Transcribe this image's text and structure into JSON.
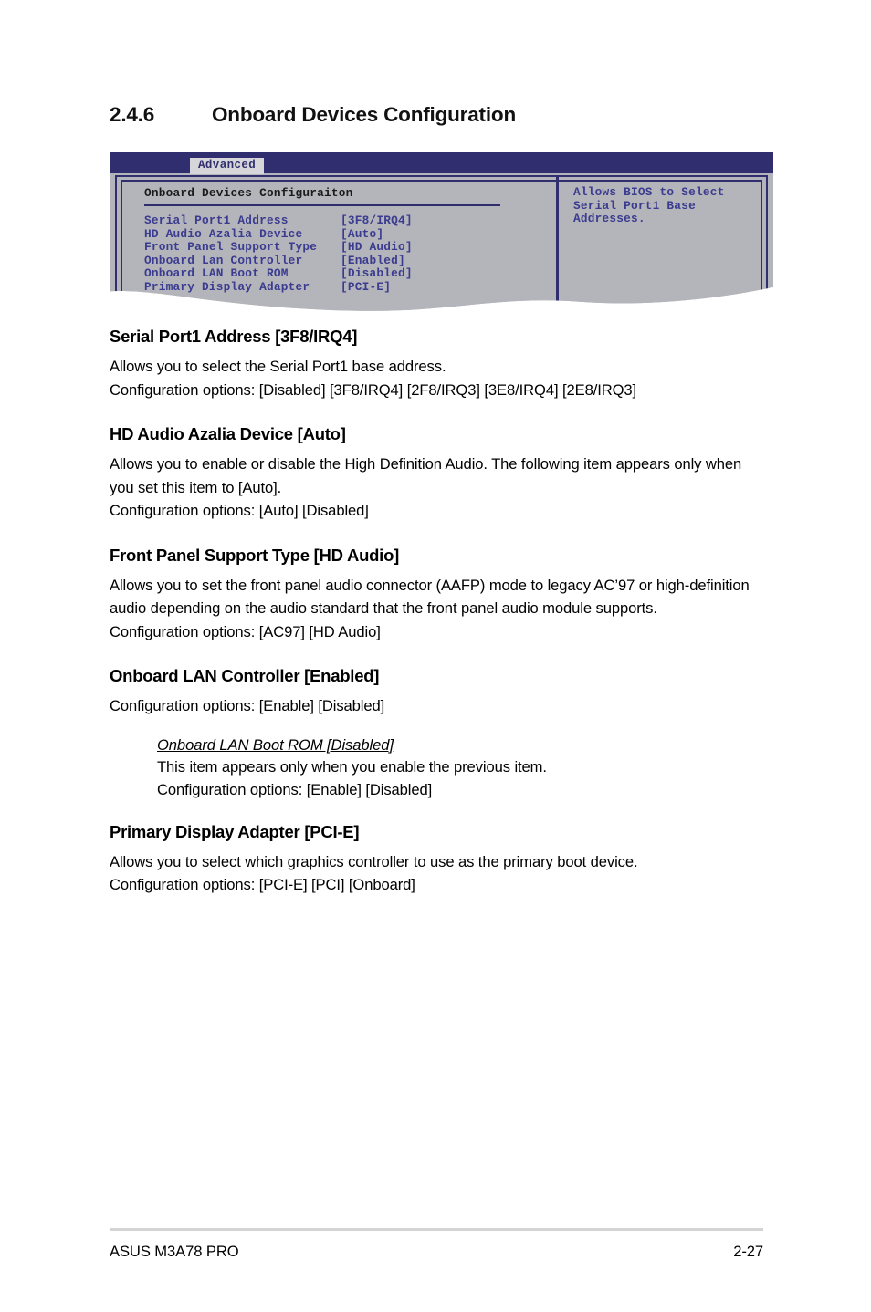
{
  "section": {
    "number": "2.4.6",
    "title": "Onboard Devices Configuration"
  },
  "bios": {
    "tab_label": "Advanced",
    "panel_title": "Onboard Devices Configuraiton",
    "items": [
      {
        "label": "Serial Port1 Address",
        "value": "[3F8/IRQ4]"
      },
      {
        "label": "HD Audio Azalia Device",
        "value": "[Auto]"
      },
      {
        "label": "Front Panel Support Type",
        "value": "[HD Audio]"
      },
      {
        "label": "Onboard Lan Controller",
        "value": "[Enabled]"
      },
      {
        "label": "Onboard LAN Boot ROM",
        "value": "[Disabled]"
      },
      {
        "label": "Primary Display Adapter",
        "value": "[PCI-E]"
      }
    ],
    "help_text": "Allows BIOS to Select\nSerial Port1 Base\nAddresses.",
    "colors": {
      "titlebar": "#302e6e",
      "panel_bg": "#b4b5bb",
      "border": "#302e6e",
      "item_text": "#3b3b8f",
      "tab_bg": "#d6d6da"
    }
  },
  "sections": [
    {
      "heading": "Serial Port1 Address [3F8/IRQ4]",
      "lines": [
        "Allows you to select the Serial Port1 base address.",
        "Configuration options: [Disabled] [3F8/IRQ4] [2F8/IRQ3] [3E8/IRQ4] [2E8/IRQ3]"
      ]
    },
    {
      "heading": "HD Audio Azalia Device [Auto]",
      "lines": [
        "Allows you to enable or disable the High Definition Audio. The following item appears only when you set this item to [Auto].",
        "Configuration options: [Auto] [Disabled]"
      ]
    },
    {
      "heading": "Front Panel Support Type [HD Audio]",
      "lines": [
        "Allows you to set the front panel audio connector (AAFP) mode to legacy AC’97 or high-definition audio depending on the audio standard that the front panel audio module supports.",
        "Configuration options: [AC97] [HD Audio]"
      ]
    },
    {
      "heading": "Onboard LAN Controller [Enabled]",
      "lines": [
        "Configuration options: [Enable] [Disabled]"
      ],
      "sub": {
        "heading": "Onboard LAN Boot ROM [Disabled]",
        "lines": [
          "This item appears only when you enable the previous item.",
          "Configuration options: [Enable] [Disabled]"
        ]
      }
    },
    {
      "heading": "Primary Display Adapter [PCI-E]",
      "lines": [
        "Allows you to select which graphics controller to use as the primary boot device.",
        "Configuration options: [PCI-E] [PCI] [Onboard]"
      ]
    }
  ],
  "footer": {
    "left": "ASUS M3A78 PRO",
    "right": "2-27"
  }
}
